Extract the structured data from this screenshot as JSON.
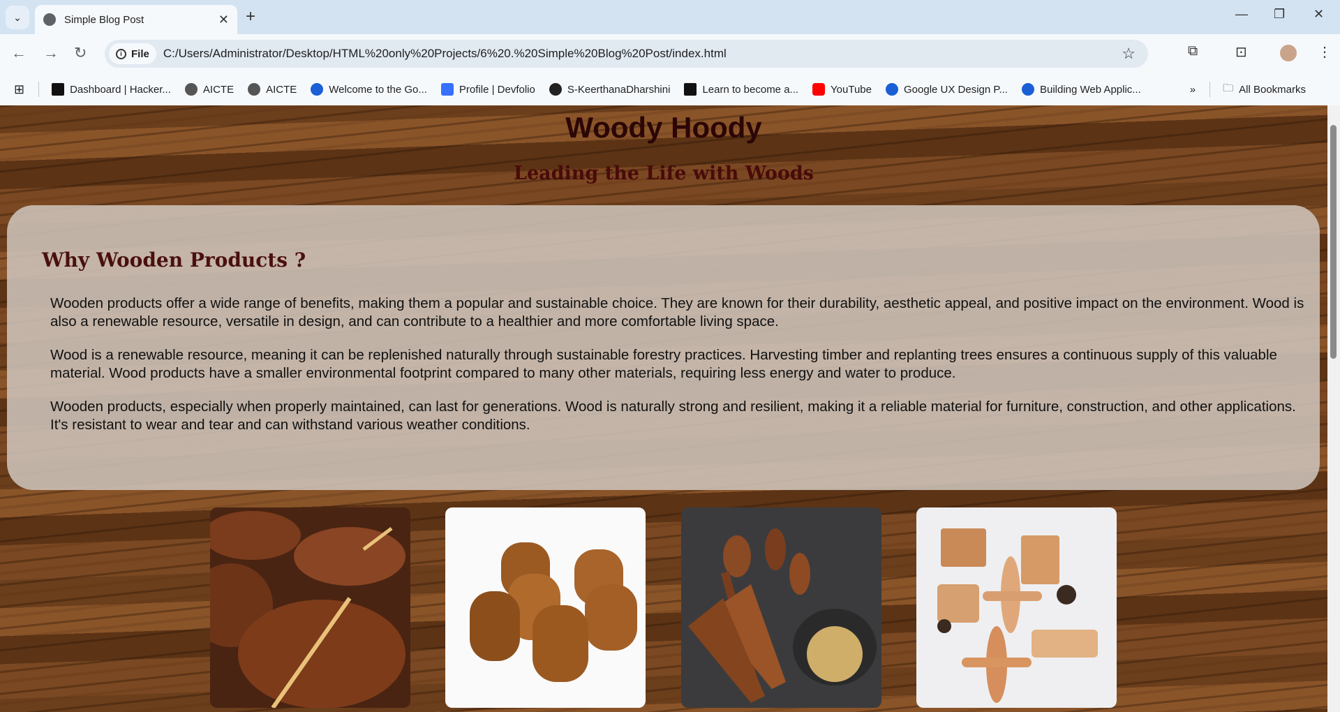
{
  "browser": {
    "tab_title": "Simple Blog Post",
    "url_chip": "File",
    "url": "C:/Users/Administrator/Desktop/HTML%20only%20Projects/6%20.%20Simple%20Blog%20Post/index.html",
    "bookmarks": [
      "Dashboard | Hacker...",
      "AICTE",
      "AICTE",
      "Welcome to the Go...",
      "Profile | Devfolio",
      "S-KeerthanaDharshini",
      "Learn to become a...",
      "YouTube",
      "Google UX Design P...",
      "Building Web Applic..."
    ],
    "all_bookmarks": "All Bookmarks",
    "colors": {
      "frame": "#d3e3f1",
      "toolbar": "#f6f9fc"
    }
  },
  "page": {
    "title": "Woody Hoody",
    "subtitle": "Leading the Life with Woods",
    "section_heading": "Why Wooden Products ?",
    "paragraphs": [
      "Wooden products offer a wide range of benefits, making them a popular and sustainable choice. They are known for their durability, aesthetic appeal, and positive impact on the environment. Wood is also a renewable resource, versatile in design, and can contribute to a healthier and more comfortable living space.",
      "Wood is a renewable resource, meaning it can be replenished naturally through sustainable forestry practices. Harvesting timber and replanting trees ensures a continuous supply of this valuable material. Wood products have a smaller environmental footprint compared to many other materials, requiring less energy and water to produce.",
      "Wooden products, especially when properly maintained, can last for generations. Wood is naturally strong and resilient, making it a reliable material for furniture, construction, and other applications. It's resistant to wear and tear and can withstand various weather conditions."
    ],
    "colors": {
      "title": "#2b0606",
      "heading": "#4a0f0f"
    }
  }
}
